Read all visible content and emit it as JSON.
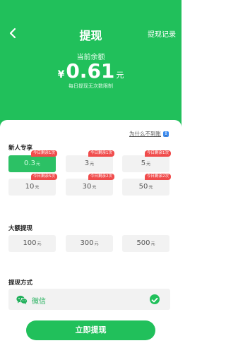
{
  "header": {
    "title": "提现",
    "record_link": "提现记录",
    "balance_label": "当前余额",
    "currency": "¥",
    "amount": "0.61",
    "unit": "元",
    "limit_note": "每日提现无次数限制",
    "bg_color": "#21c05b"
  },
  "why_link": "为什么不到账",
  "new_user": {
    "label": "新人专享",
    "options": [
      {
        "amount": "0.3",
        "unit": "元",
        "badge": "今日剩余1次",
        "selected": true
      },
      {
        "amount": "3",
        "unit": "元",
        "badge": "今日剩余1次",
        "selected": false
      },
      {
        "amount": "5",
        "unit": "元",
        "badge": "今日剩余1次",
        "selected": false
      },
      {
        "amount": "10",
        "unit": "元",
        "badge": "今日剩余5次",
        "selected": false
      },
      {
        "amount": "30",
        "unit": "元",
        "badge": "今日剩余2次",
        "selected": false
      },
      {
        "amount": "50",
        "unit": "元",
        "badge": "今日剩余2次",
        "selected": false
      }
    ]
  },
  "large": {
    "label": "大额提现",
    "options": [
      {
        "amount": "100",
        "unit": "元"
      },
      {
        "amount": "300",
        "unit": "元"
      },
      {
        "amount": "500",
        "unit": "元"
      }
    ]
  },
  "payment": {
    "label": "提现方式",
    "method": "微信",
    "method_icon": "wechat-icon",
    "checked": true
  },
  "submit_label": "立即提现"
}
